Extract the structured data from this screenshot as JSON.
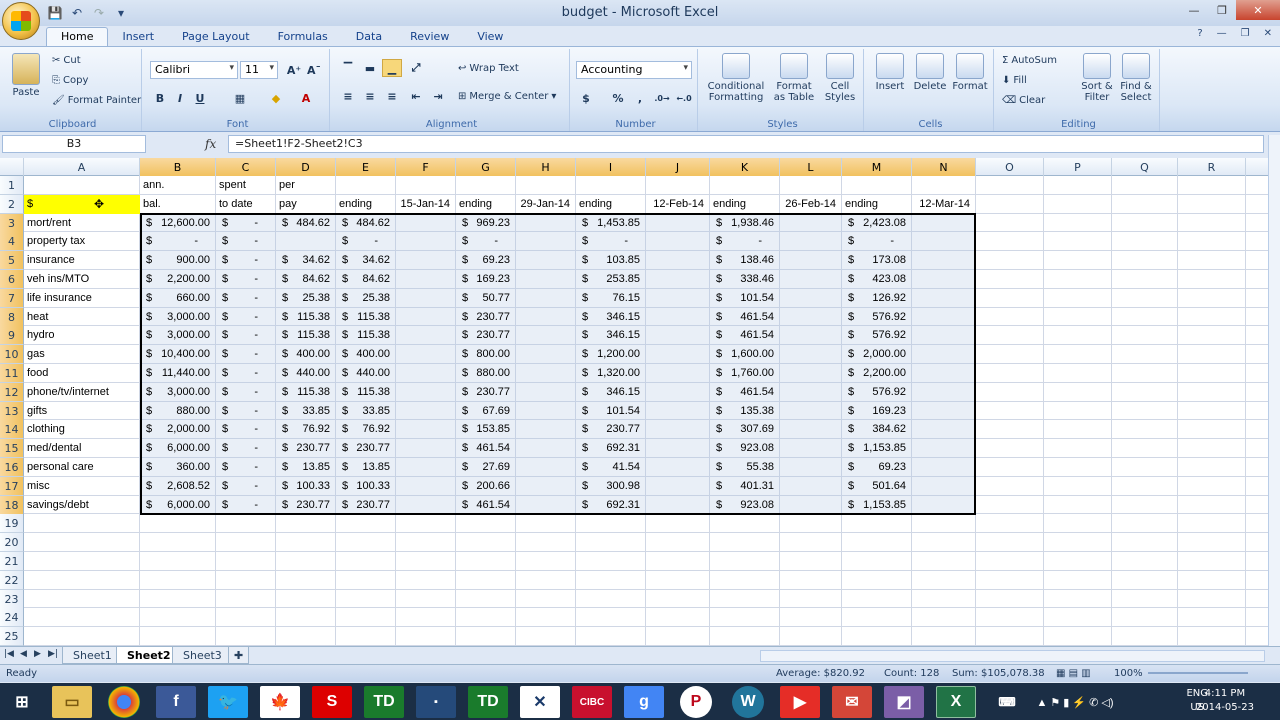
{
  "window": {
    "title": "budget - Microsoft Excel"
  },
  "tabs": [
    "Home",
    "Insert",
    "Page Layout",
    "Formulas",
    "Data",
    "Review",
    "View"
  ],
  "ribbon": {
    "clipboard": {
      "label": "Clipboard",
      "paste": "Paste",
      "cut": "Cut",
      "copy": "Copy",
      "format_painter": "Format Painter"
    },
    "font": {
      "label": "Font",
      "font_name": "Calibri",
      "font_size": "11"
    },
    "alignment": {
      "label": "Alignment",
      "wrap_text": "Wrap Text",
      "merge_center": "Merge & Center"
    },
    "number": {
      "label": "Number",
      "format": "Accounting",
      "dollar": "$",
      "percent": "%",
      "comma": ","
    },
    "styles": {
      "label": "Styles",
      "conditional": "Conditional Formatting",
      "format_table": "Format as Table",
      "cell_styles": "Cell Styles"
    },
    "cells": {
      "label": "Cells",
      "insert": "Insert",
      "delete": "Delete",
      "format": "Format"
    },
    "editing": {
      "label": "Editing",
      "autosum": "AutoSum",
      "fill": "Fill",
      "clear": "Clear",
      "sort_filter": "Sort & Filter",
      "find_select": "Find & Select"
    }
  },
  "formula_bar": {
    "name_box": "B3",
    "formula": "=Sheet1!F2-Sheet2!C3"
  },
  "grid": {
    "columns": [
      "A",
      "B",
      "C",
      "D",
      "E",
      "F",
      "G",
      "H",
      "I",
      "J",
      "K",
      "L",
      "M",
      "N",
      "O",
      "P",
      "Q",
      "R"
    ],
    "row_numbers": [
      "1",
      "2",
      "3",
      "4",
      "5",
      "6",
      "7",
      "8",
      "9",
      "10",
      "11",
      "12",
      "13",
      "14",
      "15",
      "16",
      "17",
      "18",
      "19",
      "20",
      "21",
      "22",
      "23",
      "24",
      "25"
    ],
    "header_row1": {
      "B": "ann.",
      "C": "spent",
      "D": "per"
    },
    "header_row2": {
      "A": "$",
      "B": "bal.",
      "C": "to date",
      "D": "pay",
      "E": "ending",
      "F": "15-Jan-14",
      "G": "ending",
      "H": "29-Jan-14",
      "I": "ending",
      "J": "12-Feb-14",
      "K": "ending",
      "L": "26-Feb-14",
      "M": "ending",
      "N": "12-Mar-14"
    },
    "rows": [
      {
        "label": "mort/rent",
        "B": "12,600.00",
        "C": "-",
        "D": "484.62",
        "E": "484.62",
        "G": "969.23",
        "I": "1,453.85",
        "K": "1,938.46",
        "M": "2,423.08"
      },
      {
        "label": "property tax",
        "B": "-",
        "C": "-",
        "D": "",
        "E": "-",
        "G": "-",
        "I": "-",
        "K": "-",
        "M": "-"
      },
      {
        "label": "insurance",
        "B": "900.00",
        "C": "-",
        "D": "34.62",
        "E": "34.62",
        "G": "69.23",
        "I": "103.85",
        "K": "138.46",
        "M": "173.08"
      },
      {
        "label": "veh ins/MTO",
        "B": "2,200.00",
        "C": "-",
        "D": "84.62",
        "E": "84.62",
        "G": "169.23",
        "I": "253.85",
        "K": "338.46",
        "M": "423.08"
      },
      {
        "label": "life insurance",
        "B": "660.00",
        "C": "-",
        "D": "25.38",
        "E": "25.38",
        "G": "50.77",
        "I": "76.15",
        "K": "101.54",
        "M": "126.92"
      },
      {
        "label": "heat",
        "B": "3,000.00",
        "C": "-",
        "D": "115.38",
        "E": "115.38",
        "G": "230.77",
        "I": "346.15",
        "K": "461.54",
        "M": "576.92"
      },
      {
        "label": "hydro",
        "B": "3,000.00",
        "C": "-",
        "D": "115.38",
        "E": "115.38",
        "G": "230.77",
        "I": "346.15",
        "K": "461.54",
        "M": "576.92"
      },
      {
        "label": "gas",
        "B": "10,400.00",
        "C": "-",
        "D": "400.00",
        "E": "400.00",
        "G": "800.00",
        "I": "1,200.00",
        "K": "1,600.00",
        "M": "2,000.00"
      },
      {
        "label": "food",
        "B": "11,440.00",
        "C": "-",
        "D": "440.00",
        "E": "440.00",
        "G": "880.00",
        "I": "1,320.00",
        "K": "1,760.00",
        "M": "2,200.00"
      },
      {
        "label": "phone/tv/internet",
        "B": "3,000.00",
        "C": "-",
        "D": "115.38",
        "E": "115.38",
        "G": "230.77",
        "I": "346.15",
        "K": "461.54",
        "M": "576.92"
      },
      {
        "label": "gifts",
        "B": "880.00",
        "C": "-",
        "D": "33.85",
        "E": "33.85",
        "G": "67.69",
        "I": "101.54",
        "K": "135.38",
        "M": "169.23"
      },
      {
        "label": "clothing",
        "B": "2,000.00",
        "C": "-",
        "D": "76.92",
        "E": "76.92",
        "G": "153.85",
        "I": "230.77",
        "K": "307.69",
        "M": "384.62"
      },
      {
        "label": "med/dental",
        "B": "6,000.00",
        "C": "-",
        "D": "230.77",
        "E": "230.77",
        "G": "461.54",
        "I": "692.31",
        "K": "923.08",
        "M": "1,153.85"
      },
      {
        "label": "personal care",
        "B": "360.00",
        "C": "-",
        "D": "13.85",
        "E": "13.85",
        "G": "27.69",
        "I": "41.54",
        "K": "55.38",
        "M": "69.23"
      },
      {
        "label": "misc",
        "B": "2,608.52",
        "C": "-",
        "D": "100.33",
        "E": "100.33",
        "G": "200.66",
        "I": "300.98",
        "K": "401.31",
        "M": "501.64"
      },
      {
        "label": "savings/debt",
        "B": "6,000.00",
        "C": "-",
        "D": "230.77",
        "E": "230.77",
        "G": "461.54",
        "I": "692.31",
        "K": "923.08",
        "M": "1,153.85"
      }
    ],
    "currency_symbol": "$"
  },
  "sheets": [
    "Sheet1",
    "Sheet2",
    "Sheet3"
  ],
  "active_sheet": "Sheet2",
  "status": {
    "ready": "Ready",
    "average": "Average: $820.92",
    "count": "Count: 128",
    "sum": "Sum: $105,078.38",
    "zoom": "100%"
  },
  "taskbar": {
    "lang_top": "ENG",
    "lang_bottom": "US",
    "time": "4:11 PM",
    "date": "2014-05-23"
  },
  "colors": {
    "accent_yellow": "#ffff00",
    "selected_header": "#f1c15f"
  }
}
